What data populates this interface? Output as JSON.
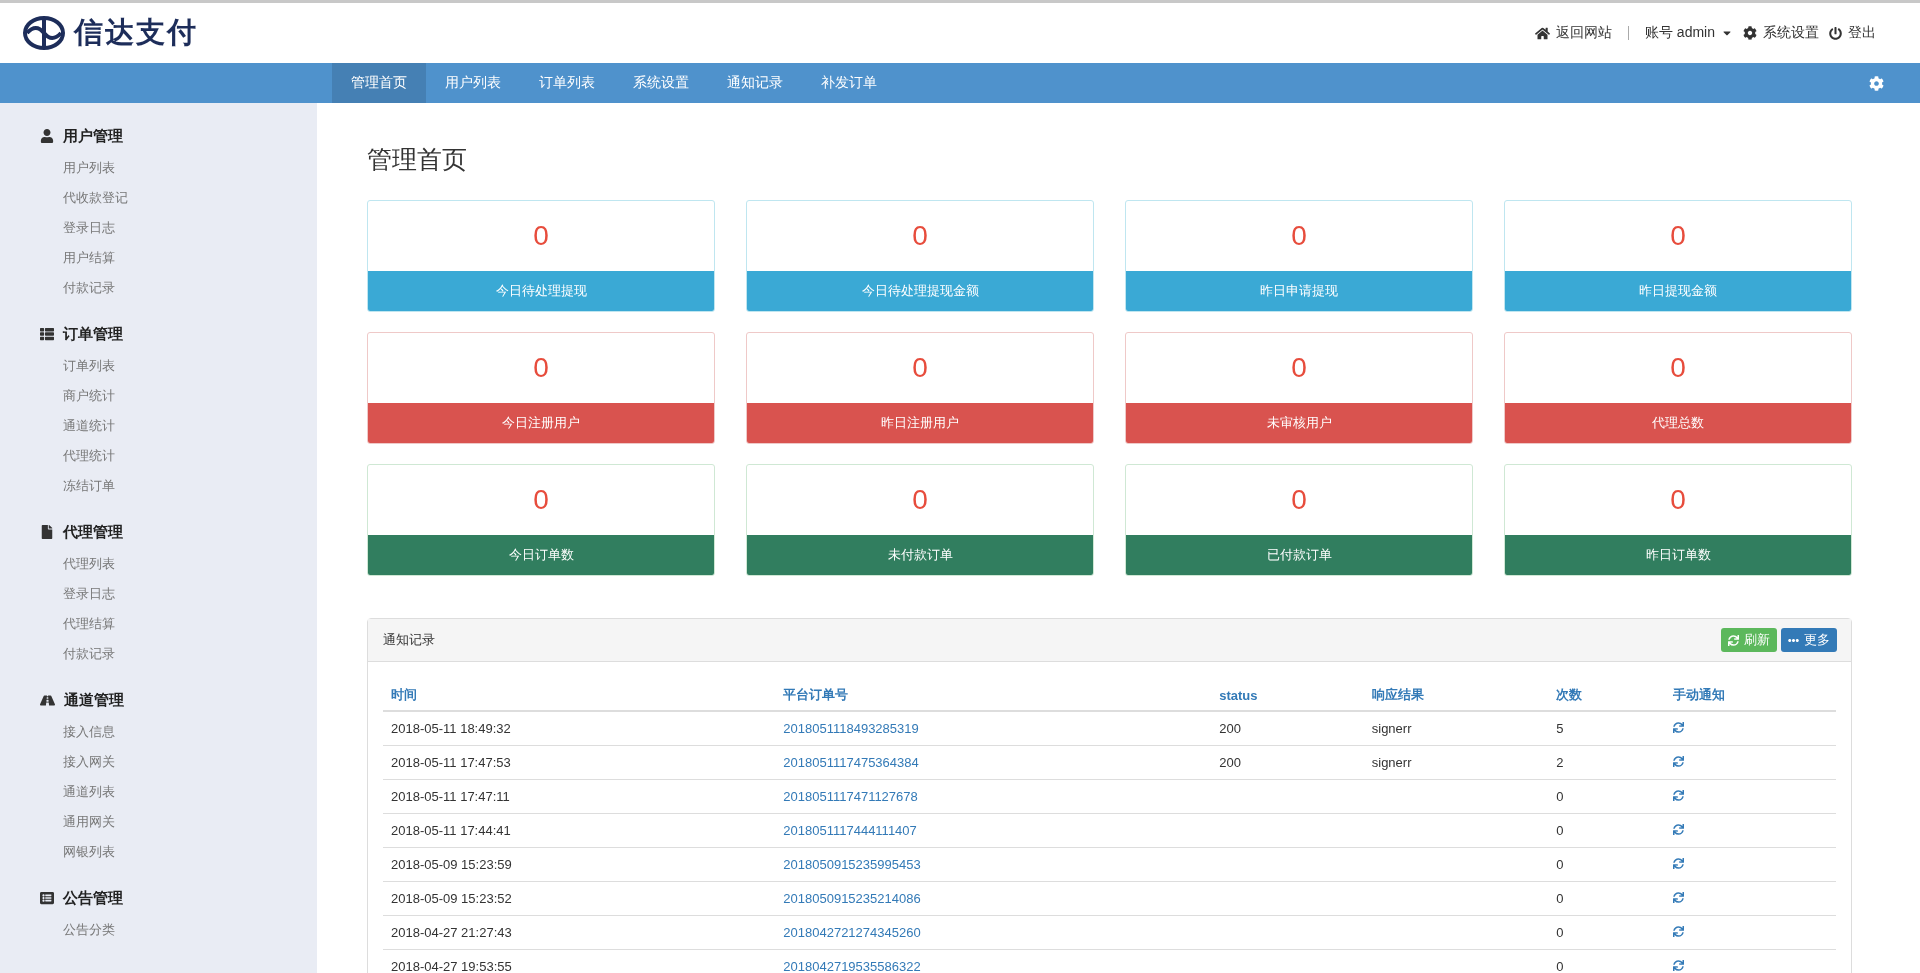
{
  "brand": {
    "name": "信达支付"
  },
  "top_links": [
    {
      "kind": "home",
      "label": "返回网站"
    },
    {
      "kind": "account",
      "label": "账号 admin"
    },
    {
      "kind": "settings",
      "label": "系统设置"
    },
    {
      "kind": "logout",
      "label": "登出"
    }
  ],
  "nav_tabs": [
    {
      "label": "管理首页",
      "selected": true
    },
    {
      "label": "用户列表",
      "selected": false
    },
    {
      "label": "订单列表",
      "selected": false
    },
    {
      "label": "系统设置",
      "selected": false
    },
    {
      "label": "通知记录",
      "selected": false
    },
    {
      "label": "补发订单",
      "selected": false
    }
  ],
  "sidebar": [
    {
      "kind": "user",
      "title": "用户管理",
      "items": [
        "用户列表",
        "代收款登记",
        "登录日志",
        "用户结算",
        "付款记录"
      ]
    },
    {
      "kind": "list",
      "title": "订单管理",
      "items": [
        "订单列表",
        "商户统计",
        "通道统计",
        "代理统计",
        "冻结订单"
      ]
    },
    {
      "kind": "file",
      "title": "代理管理",
      "items": [
        "代理列表",
        "登录日志",
        "代理结算",
        "付款记录"
      ]
    },
    {
      "kind": "road",
      "title": "通道管理",
      "items": [
        "接入信息",
        "接入网关",
        "通道列表",
        "通用网关",
        "网银列表"
      ]
    },
    {
      "kind": "notice",
      "title": "公告管理",
      "items": [
        "公告分类"
      ]
    }
  ],
  "page_title": "管理首页",
  "stat_rows": [
    {
      "kind": "info",
      "cards": [
        {
          "value": "0",
          "label": "今日待处理提现"
        },
        {
          "value": "0",
          "label": "今日待处理提现金额"
        },
        {
          "value": "0",
          "label": "昨日申请提现"
        },
        {
          "value": "0",
          "label": "昨日提现金额"
        }
      ]
    },
    {
      "kind": "danger",
      "cards": [
        {
          "value": "0",
          "label": "今日注册用户"
        },
        {
          "value": "0",
          "label": "昨日注册用户"
        },
        {
          "value": "0",
          "label": "未审核用户"
        },
        {
          "value": "0",
          "label": "代理总数"
        }
      ]
    },
    {
      "kind": "success",
      "cards": [
        {
          "value": "0",
          "label": "今日订单数"
        },
        {
          "value": "0",
          "label": "未付款订单"
        },
        {
          "value": "0",
          "label": "已付款订单"
        },
        {
          "value": "0",
          "label": "昨日订单数"
        }
      ]
    }
  ],
  "notice_panel": {
    "title": "通知记录",
    "buttons": [
      {
        "kind": "refresh",
        "label": "刷新"
      },
      {
        "kind": "more",
        "label": "更多"
      }
    ],
    "columns": [
      "时间",
      "平台订单号",
      "status",
      "响应结果",
      "次数",
      "手动通知"
    ],
    "rows": [
      {
        "time": "2018-05-11 18:49:32",
        "order": "2018051118493285319",
        "status": "200",
        "result": "signerr",
        "count": "5"
      },
      {
        "time": "2018-05-11 17:47:53",
        "order": "2018051117475364384",
        "status": "200",
        "result": "signerr",
        "count": "2"
      },
      {
        "time": "2018-05-11 17:47:11",
        "order": "2018051117471127678",
        "count": "0"
      },
      {
        "time": "2018-05-11 17:44:41",
        "order": "2018051117444111407",
        "count": "0"
      },
      {
        "time": "2018-05-09 15:23:59",
        "order": "2018050915235995453",
        "count": "0"
      },
      {
        "time": "2018-05-09 15:23:52",
        "order": "2018050915235214086",
        "count": "0"
      },
      {
        "time": "2018-04-27 21:27:43",
        "order": "2018042721274345260",
        "count": "0"
      },
      {
        "time": "2018-04-27 19:53:55",
        "order": "2018042719535586322",
        "count": "0"
      }
    ]
  }
}
